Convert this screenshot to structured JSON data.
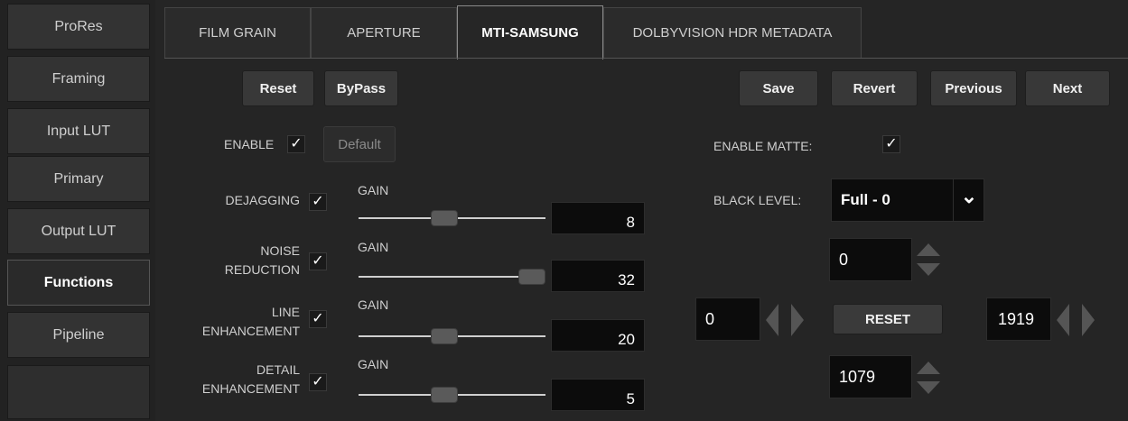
{
  "sidebar": {
    "items": [
      {
        "label": "ProRes"
      },
      {
        "label": "Framing"
      },
      {
        "label": "Input LUT"
      },
      {
        "label": "Primary"
      },
      {
        "label": "Output LUT"
      },
      {
        "label": "Functions",
        "active": true
      },
      {
        "label": "Pipeline"
      }
    ]
  },
  "tabs": [
    {
      "label": "FILM GRAIN"
    },
    {
      "label": "APERTURE"
    },
    {
      "label": "MTI-SAMSUNG",
      "active": true
    },
    {
      "label": "DOLBYVISION HDR METADATA"
    }
  ],
  "toolbar": {
    "reset": "Reset",
    "bypass": "ByPass",
    "save": "Save",
    "revert": "Revert",
    "previous": "Previous",
    "next": "Next",
    "default": "Default"
  },
  "enable": {
    "label": "ENABLE",
    "checked": true
  },
  "controls": [
    {
      "label_lines": [
        "DEJAGGING"
      ],
      "checked": true,
      "gain_label": "GAIN",
      "value": "8",
      "level": 0.45
    },
    {
      "label_lines": [
        "NOISE",
        "REDUCTION"
      ],
      "checked": true,
      "gain_label": "GAIN",
      "value": "32",
      "level": 1.0
    },
    {
      "label_lines": [
        "LINE",
        "ENHANCEMENT"
      ],
      "checked": true,
      "gain_label": "GAIN",
      "value": "20",
      "level": 0.45
    },
    {
      "label_lines": [
        "DETAIL",
        "ENHANCEMENT"
      ],
      "checked": true,
      "gain_label": "GAIN",
      "value": "5",
      "level": 0.45
    }
  ],
  "matte": {
    "enable_label": "ENABLE MATTE:",
    "enable_checked": true,
    "black_level_label": "BLACK LEVEL:",
    "black_level_value": "Full - 0",
    "top": "0",
    "left": "0",
    "right": "1919",
    "bottom": "1079",
    "reset": "RESET"
  },
  "check_glyph": "✓",
  "chevron_glyph": "⌄",
  "colors": {
    "background": "#252525",
    "active_tab_border": "#8a8a8a"
  }
}
